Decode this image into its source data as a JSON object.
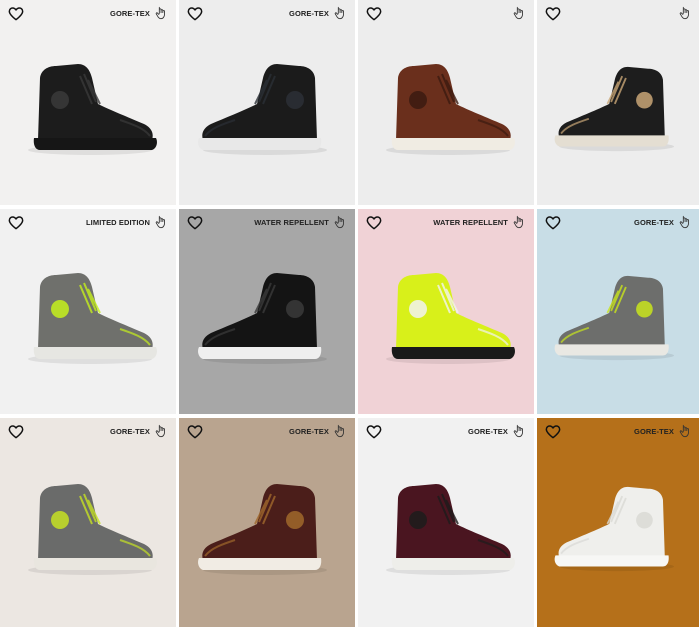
{
  "products": [
    {
      "badge": "GORE-TEX",
      "bg": "#f2f1f0",
      "colors": {
        "upper": "#1c1c1c",
        "sole": "#161616",
        "accent": "#3a3a3a"
      }
    },
    {
      "badge": "GORE-TEX",
      "bg": "#ededed",
      "colors": {
        "upper": "#1b1b1b",
        "sole": "#e8e8e8",
        "accent": "#2b2f36"
      }
    },
    {
      "badge": "",
      "bg": "#ededed",
      "colors": {
        "upper": "#6a2f1c",
        "sole": "#f0ece3",
        "accent": "#3b1a10"
      }
    },
    {
      "badge": "",
      "bg": "#ededed",
      "colors": {
        "upper": "#1d1d1d",
        "sole": "#e4ded2",
        "accent": "#c9a677"
      }
    },
    {
      "badge": "LIMITED EDITION",
      "bg": "#f1f1f1",
      "colors": {
        "upper": "#6f706c",
        "sole": "#e6e6e2",
        "accent": "#c6f01c"
      }
    },
    {
      "badge": "WATER REPELLENT",
      "bg": "#a7a7a7",
      "colors": {
        "upper": "#141414",
        "sole": "#efefef",
        "accent": "#3a3a3a"
      }
    },
    {
      "badge": "WATER REPELLENT",
      "bg": "#f0d2d6",
      "colors": {
        "upper": "#d8f01a",
        "sole": "#1a1a1a",
        "accent": "#f2f2f2"
      }
    },
    {
      "badge": "GORE-TEX",
      "bg": "#c8dde6",
      "colors": {
        "upper": "#6d6e6c",
        "sole": "#e9e8e3",
        "accent": "#c9e51c"
      }
    },
    {
      "badge": "GORE-TEX",
      "bg": "#ece7e2",
      "colors": {
        "upper": "#6a6b6a",
        "sole": "#e9e6df",
        "accent": "#c6e123"
      }
    },
    {
      "badge": "GORE-TEX",
      "bg": "#b9a48f",
      "colors": {
        "upper": "#4b1e1a",
        "sole": "#f1ece4",
        "accent": "#a0682c"
      }
    },
    {
      "badge": "GORE-TEX",
      "bg": "#f1f1f1",
      "colors": {
        "upper": "#4a1520",
        "sole": "#eeeeea",
        "accent": "#1c1c1c"
      }
    },
    {
      "badge": "GORE-TEX",
      "bg": "#b5701a",
      "colors": {
        "upper": "#efefec",
        "sole": "#f7f7f5",
        "accent": "#d9d9d5"
      }
    }
  ],
  "icons": {
    "favorite": "heart-outline-icon",
    "selector": "hand-pointer-icon"
  }
}
